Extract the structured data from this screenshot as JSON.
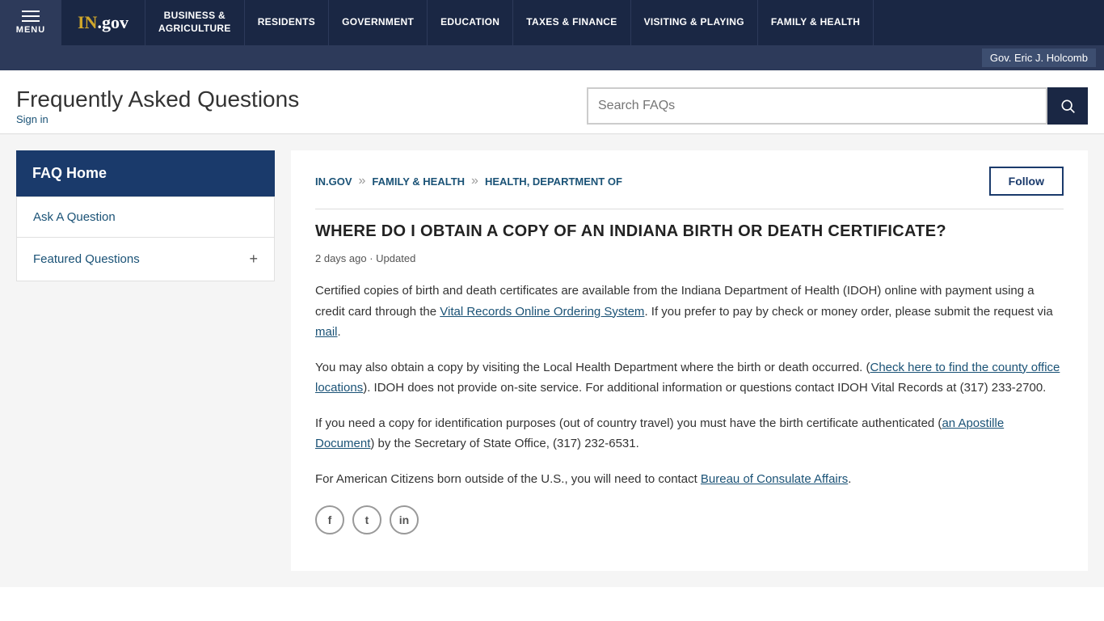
{
  "topNav": {
    "menuLabel": "MENU",
    "logoText": "IN.gov",
    "items": [
      {
        "id": "business",
        "label": "BUSINESS &\nAGRICULTURE"
      },
      {
        "id": "residents",
        "label": "RESIDENTS"
      },
      {
        "id": "government",
        "label": "GOVERNMENT"
      },
      {
        "id": "education",
        "label": "EDUCATION"
      },
      {
        "id": "taxes",
        "label": "TAXES & FINANCE"
      },
      {
        "id": "visiting",
        "label": "VISITING & PLAYING"
      },
      {
        "id": "family",
        "label": "FAMILY & HEALTH"
      }
    ]
  },
  "govBar": {
    "text": "Gov. Eric J. Holcomb"
  },
  "header": {
    "title": "Frequently Asked Questions",
    "signIn": "Sign in",
    "searchPlaceholder": "Search FAQs"
  },
  "sidebar": {
    "homeLabel": "FAQ Home",
    "items": [
      {
        "id": "ask",
        "label": "Ask A Question",
        "hasPlus": false
      },
      {
        "id": "featured",
        "label": "Featured Questions",
        "hasPlus": true
      }
    ]
  },
  "breadcrumb": {
    "links": [
      {
        "id": "ingov",
        "label": "IN.GOV"
      },
      {
        "id": "family",
        "label": "FAMILY & HEALTH"
      },
      {
        "id": "health",
        "label": "HEALTH, DEPARTMENT OF"
      }
    ],
    "followLabel": "Follow"
  },
  "question": {
    "title": "WHERE DO I OBTAIN A COPY OF AN INDIANA BIRTH OR DEATH CERTIFICATE?",
    "meta": "2 days ago · Updated",
    "paragraphs": [
      {
        "id": "p1",
        "before": "Certified copies of birth and death certificates are available from the Indiana Department of Health (IDOH) online with payment using a credit card through the ",
        "link1": {
          "text": "Vital Records Online Ordering System",
          "href": "#"
        },
        "after1": ". If you prefer to pay by check or money order, please submit the request via ",
        "link2": {
          "text": "mail",
          "href": "#"
        },
        "after2": "."
      },
      {
        "id": "p2",
        "before": "You may also obtain a copy by visiting the Local Health Department where the birth or death occurred. (",
        "link1": {
          "text": "Check here to find the county office locations",
          "href": "#"
        },
        "after1": "). IDOH does not provide on-site service. For additional information or questions contact IDOH Vital Records at (317) 233-2700.",
        "link2": null,
        "after2": ""
      },
      {
        "id": "p3",
        "before": "If you need a copy for identification purposes (out of country travel) you must have the birth certificate authenticated (",
        "link1": {
          "text": "an Apostille Document",
          "href": "#"
        },
        "after1": ") by the Secretary of State Office, (317) 232-6531.",
        "link2": null,
        "after2": ""
      },
      {
        "id": "p4",
        "before": "For American Citizens born outside of the U.S., you will need to contact ",
        "link1": {
          "text": "Bureau of Consulate Affairs",
          "href": "#"
        },
        "after1": ".",
        "link2": null,
        "after2": ""
      }
    ]
  },
  "social": {
    "icons": [
      "f",
      "t",
      "in"
    ]
  }
}
